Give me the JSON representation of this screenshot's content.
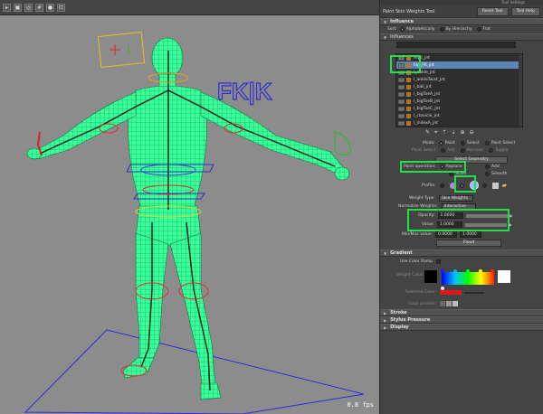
{
  "panel": {
    "window_title": "Tool Settings",
    "tool_name": "Paint Skin Weights Tool",
    "reset_tool": "Reset Tool",
    "tool_help": "Tool Help"
  },
  "influence": {
    "section_label": "Influence",
    "sort_label": "Sort:",
    "sort_options": [
      "Alphabetically",
      "By Hierarchy",
      "Flat"
    ],
    "sort_selected": "Alphabetically",
    "influences_label": "Influences",
    "items": [
      "Hips_jnt",
      "hip_FK_jnt",
      "l_ankle_jnt",
      "l_ankleTwist_jnt",
      "l_ball_jnt",
      "l_bigToeA_jnt",
      "l_bigToeB_jnt",
      "l_bigToeC_jnt",
      "l_clavicle_jnt",
      "l_indexA_jnt"
    ],
    "selected_index": 1
  },
  "mode": {
    "label": "Mode:",
    "options": [
      "Paint",
      "Select",
      "Paint Select"
    ],
    "selected": "Paint",
    "paint_select_label": "Paint Select:",
    "paint_select_options": [
      "Add",
      "Remove",
      "Toggle"
    ],
    "select_geometry": "Select Geometry"
  },
  "paint_operation": {
    "label": "Paint operation:",
    "options": [
      "Replace",
      "Add",
      "Scale",
      "Smooth"
    ],
    "selected": "Replace"
  },
  "profile": {
    "label": "Profile:"
  },
  "weight_type": {
    "label": "Weight Type:",
    "value": "Skin Weights"
  },
  "normalize": {
    "label": "Normalize Weights:",
    "value": "Interactive"
  },
  "opacity": {
    "label": "Opacity:",
    "value": "1.0000",
    "level": 1.0
  },
  "value": {
    "label": "Value:",
    "value": "1.0000",
    "level": 1.0
  },
  "minmax": {
    "label": "Min/Max value:",
    "min": "0.0000",
    "max": "1.0000"
  },
  "flood": "Flood",
  "gradient": {
    "section_label": "Gradient",
    "use_color_ramp": "Use Color Ramp",
    "weight_color_label": "Weight Color:",
    "selected_color_label": "Selected Color:",
    "color_presets_label": "Color presets:"
  },
  "collapsed_sections": [
    "Stroke",
    "Stylus Pressure",
    "Display"
  ],
  "viewport": {
    "fps": "0.8 fps",
    "rig_label": "FK|K"
  },
  "colors": {
    "accent_highlight": "#22e04a",
    "mesh": "#39ff9a",
    "selection": "#5b86b6"
  }
}
